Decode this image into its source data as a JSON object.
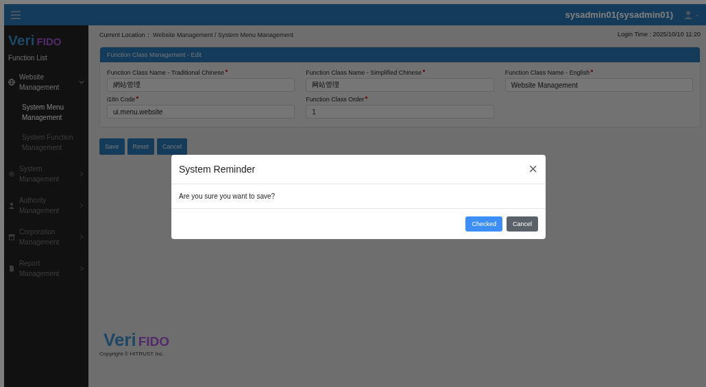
{
  "top_bar": {
    "user": "sysadmin01(sysadmin01)"
  },
  "sidebar": {
    "logo": {
      "veri": "Veri",
      "fido": "FIDO"
    },
    "heading": "Function List",
    "items": [
      {
        "label": "Website Management",
        "kind": "globe",
        "expanded": true,
        "children": [
          {
            "label": "System Menu Management",
            "selected": true
          },
          {
            "label": "System Function Management",
            "selected": false
          }
        ]
      },
      {
        "label": "System Management",
        "kind": "gear",
        "expanded": false
      },
      {
        "label": "Authority Management",
        "kind": "person",
        "expanded": false
      },
      {
        "label": "Corporation Management",
        "kind": "store",
        "expanded": false
      },
      {
        "label": "Report Management",
        "kind": "report",
        "expanded": false
      }
    ]
  },
  "breadcrumb": {
    "label": "Current Location：",
    "path": "Website Management  /  System Menu Management"
  },
  "login_time": "Login Time : 2025/10/10 11:20",
  "form": {
    "title": "Function Class Management - Edit",
    "fields": [
      {
        "label": "Function Class Name - Traditional Chinese",
        "required": true,
        "value": "網站管理"
      },
      {
        "label": "Function Class Name - Simplified Chinese",
        "required": true,
        "value": "网站管理"
      },
      {
        "label": "Function Class Name - English",
        "required": true,
        "value": "Website Management"
      },
      {
        "label": "i18n Code ",
        "required": true,
        "value": "ui.menu.website"
      },
      {
        "label": "Function Class Order ",
        "required": true,
        "value": "1"
      }
    ],
    "buttons": [
      "Save",
      "Reset",
      "Cancel"
    ]
  },
  "footer": {
    "logo": {
      "veri": "Veri",
      "fido": "FIDO"
    },
    "copyright": "Copyright © HITRUST Inc."
  },
  "modal": {
    "title": "System Reminder",
    "close": "×",
    "message": "Are you sure you want to save?",
    "buttons": [
      {
        "label": "Checked",
        "kind": "primary"
      },
      {
        "label": "Cancel",
        "kind": "secondary"
      }
    ]
  }
}
